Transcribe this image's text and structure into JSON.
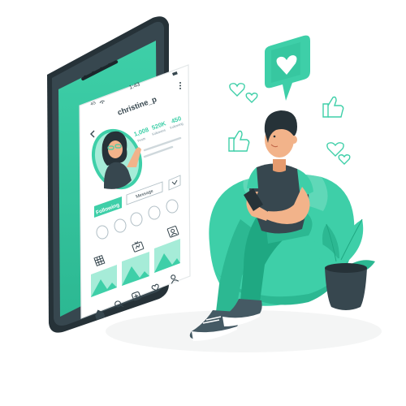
{
  "colors": {
    "accent": "#3ecfa8",
    "accent_dark": "#1fa882",
    "accent_light": "#a6ecd8",
    "phone_body": "#2f3b41",
    "skin": "#f2b38a",
    "hair": "#263238",
    "shirt": "#37474f"
  },
  "status_bar": {
    "time": "1:43",
    "signal": "4G"
  },
  "profile": {
    "username": "christine_p",
    "stats": [
      {
        "value": "1,008",
        "label": "Posts"
      },
      {
        "value": "520K",
        "label": "Followers"
      },
      {
        "value": "450",
        "label": "Following"
      }
    ],
    "following_button": "Following",
    "message_button": "Message"
  },
  "icons": {
    "back": "chevron-left-icon",
    "menu": "kebab-menu-icon",
    "grid": "grid-icon",
    "tv": "tv-icon",
    "tagged": "tagged-photo-icon",
    "home": "home-icon",
    "search": "search-icon",
    "add": "add-post-icon",
    "heart": "heart-icon",
    "user": "user-icon"
  }
}
